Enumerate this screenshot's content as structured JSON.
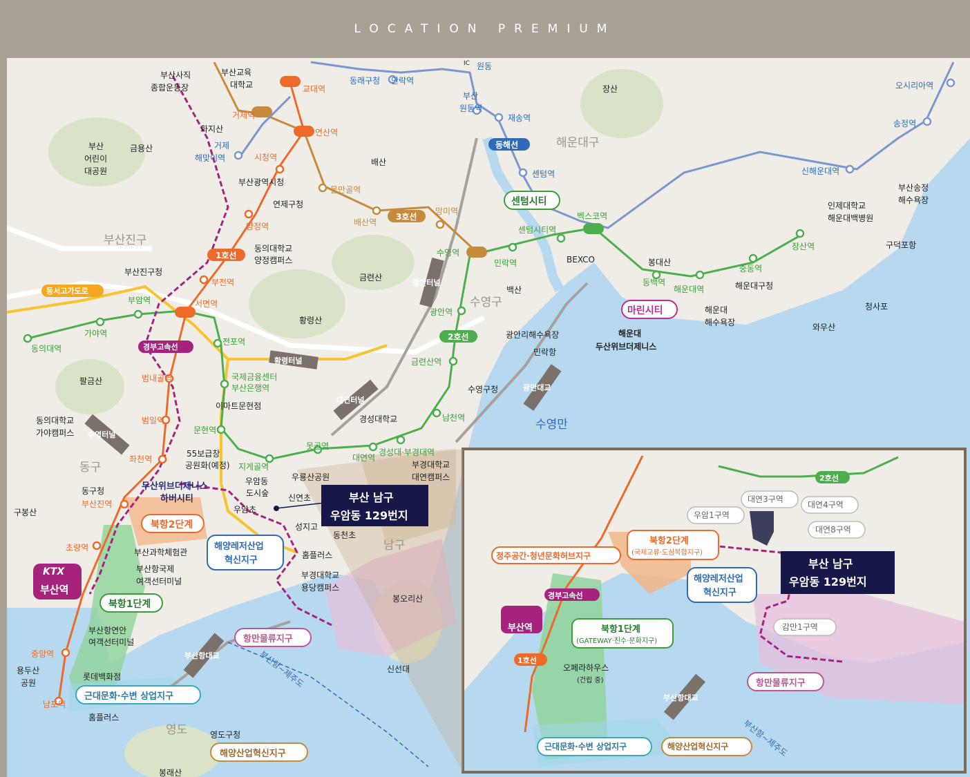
{
  "header": {
    "title": "LOCATION PREMIUM"
  },
  "target": {
    "line1": "부산 남구",
    "line2": "우암동 129번지"
  },
  "line_badges": {
    "line1": "1호선",
    "line2": "2호선",
    "line3": "3호선",
    "donghae": "동해선",
    "gyeongbu": "경부고속선"
  },
  "road_badges": {
    "dongseo": "동서고가도로",
    "hwangryeong": "황령터널",
    "daeyeon": "대연터널",
    "suyeong": "수영터널",
    "gwangan": "광안대교",
    "busanhang": "부산항대교",
    "gwangan_tunnel": "광안터널"
  },
  "ktx": {
    "logo": "KTX",
    "station": "부산역"
  },
  "districts": {
    "busanjin": "부산진구",
    "haeundae": "해운대구",
    "suyeong": "수영구",
    "dong": "동구",
    "nam": "남구",
    "yeongdo": "영도",
    "suyeongman": "수영만"
  },
  "zones": {
    "centum": "센텀시티",
    "marine": "마린시티",
    "bukhang2": "북항2단계",
    "bukhang1": "북항1단계",
    "haeyang1": "해양레저산업",
    "haeyang2": "혁신지구",
    "hangman": "항만물류지구",
    "geundae": "근대문화·수변 상업지구",
    "haeyangsan": "해양산업혁신지구",
    "doosan1": "두산위브더제니스",
    "doosan2": "하버시티",
    "marine_doosan1": "해운대",
    "marine_doosan2": "두산위브더제니스"
  },
  "orange_stations": [
    "교대역",
    "거제역",
    "연산역",
    "시청역",
    "양정역",
    "부전역",
    "서면역",
    "범내골역",
    "범일역",
    "좌천역",
    "부산진역",
    "초량역",
    "중앙역",
    "남포역"
  ],
  "green_stations": [
    "부암역",
    "가야역",
    "동의대역",
    "전포역",
    "국제금융센터",
    "부산은행역",
    "문현역",
    "지게골역",
    "못골역",
    "대연역",
    "경성대·부경대역",
    "남천역",
    "금련산역",
    "광안역",
    "수영역",
    "민락역",
    "센텀시티역",
    "벡스코역",
    "동백역",
    "해운대역",
    "중동역",
    "장산역"
  ],
  "gold_stations": [
    "거제역",
    "물만골역",
    "배산역",
    "망미역"
  ],
  "blue_stations": [
    "원동",
    "부산",
    "원동역",
    "재송역",
    "센텀역",
    "동래구청",
    "안락역",
    "거제",
    "해맞이역",
    "신해운대역",
    "송정역",
    "오시리아역"
  ],
  "places": [
    "부산사직",
    "종합운동장",
    "부산교육",
    "대학교",
    "화지산",
    "금용산",
    "부산",
    "어린이",
    "대공원",
    "배산",
    "부산광역시청",
    "연제구청",
    "동의대학교",
    "양정캠퍼스",
    "부산진구청",
    "금련산",
    "황령산",
    "이마트문현점",
    "동의대학교",
    "가야캠퍼스",
    "팔금산",
    "경성대학교",
    "55보급창",
    "공원화(예정)",
    "우암동",
    "도시숲",
    "우암초",
    "신연초",
    "성지고",
    "동천초",
    "홈플러스",
    "부경대학교",
    "용당캠퍼스",
    "부경대학교",
    "대연캠퍼스",
    "봉오리산",
    "신선대",
    "부산과학체험관",
    "부산항국제",
    "여객선터미널",
    "부산항연안",
    "여객선터미널",
    "롯데백화점",
    "홈플러스",
    "영도구청",
    "봉래산",
    "동구청",
    "구봉산",
    "용두산",
    "공원",
    "장산",
    "봉대산",
    "BEXCO",
    "백산",
    "광안리해수욕장",
    "민락항",
    "수영구청",
    "해운대구청",
    "해운대",
    "해수욕장",
    "인제대학교",
    "해운대백병원",
    "부산송정",
    "해수욕장",
    "구덕포항",
    "청사포",
    "와우산",
    "우룡산공원"
  ],
  "inset": {
    "target1": "부산 남구",
    "target2": "우암동 129번지",
    "bukhang2_1": "북항2단계",
    "bukhang2_2": "(국제교류·도심복합지구)",
    "bukhang1_1": "북항1단계",
    "bukhang1_2": "(GATEWAY·친수·문화지구)",
    "jungju": "정주공간·청년문화허브지구",
    "haeyang1": "해양레저산업",
    "haeyang2": "혁신지구",
    "hangman": "항만물류지구",
    "geundae": "근대문화·수변 상업지구",
    "haeyangsan": "해양산업혁신지구",
    "gyeongbu": "경부고속선",
    "line1": "1호선",
    "line2": "2호선",
    "ktx_station": "부산역",
    "busanhang": "부산항대교",
    "ferry": "부산항~제주도",
    "opera1": "오페라하우스",
    "opera2": "(건립 중)",
    "daeyeon3": "대연3구역",
    "daeyeon4": "대연4구역",
    "daeyeon8": "대연8구역",
    "uam1": "우암1구역",
    "gamman1": "감만1구역"
  },
  "ferry": "부산항~제주도",
  "ic": "IC"
}
